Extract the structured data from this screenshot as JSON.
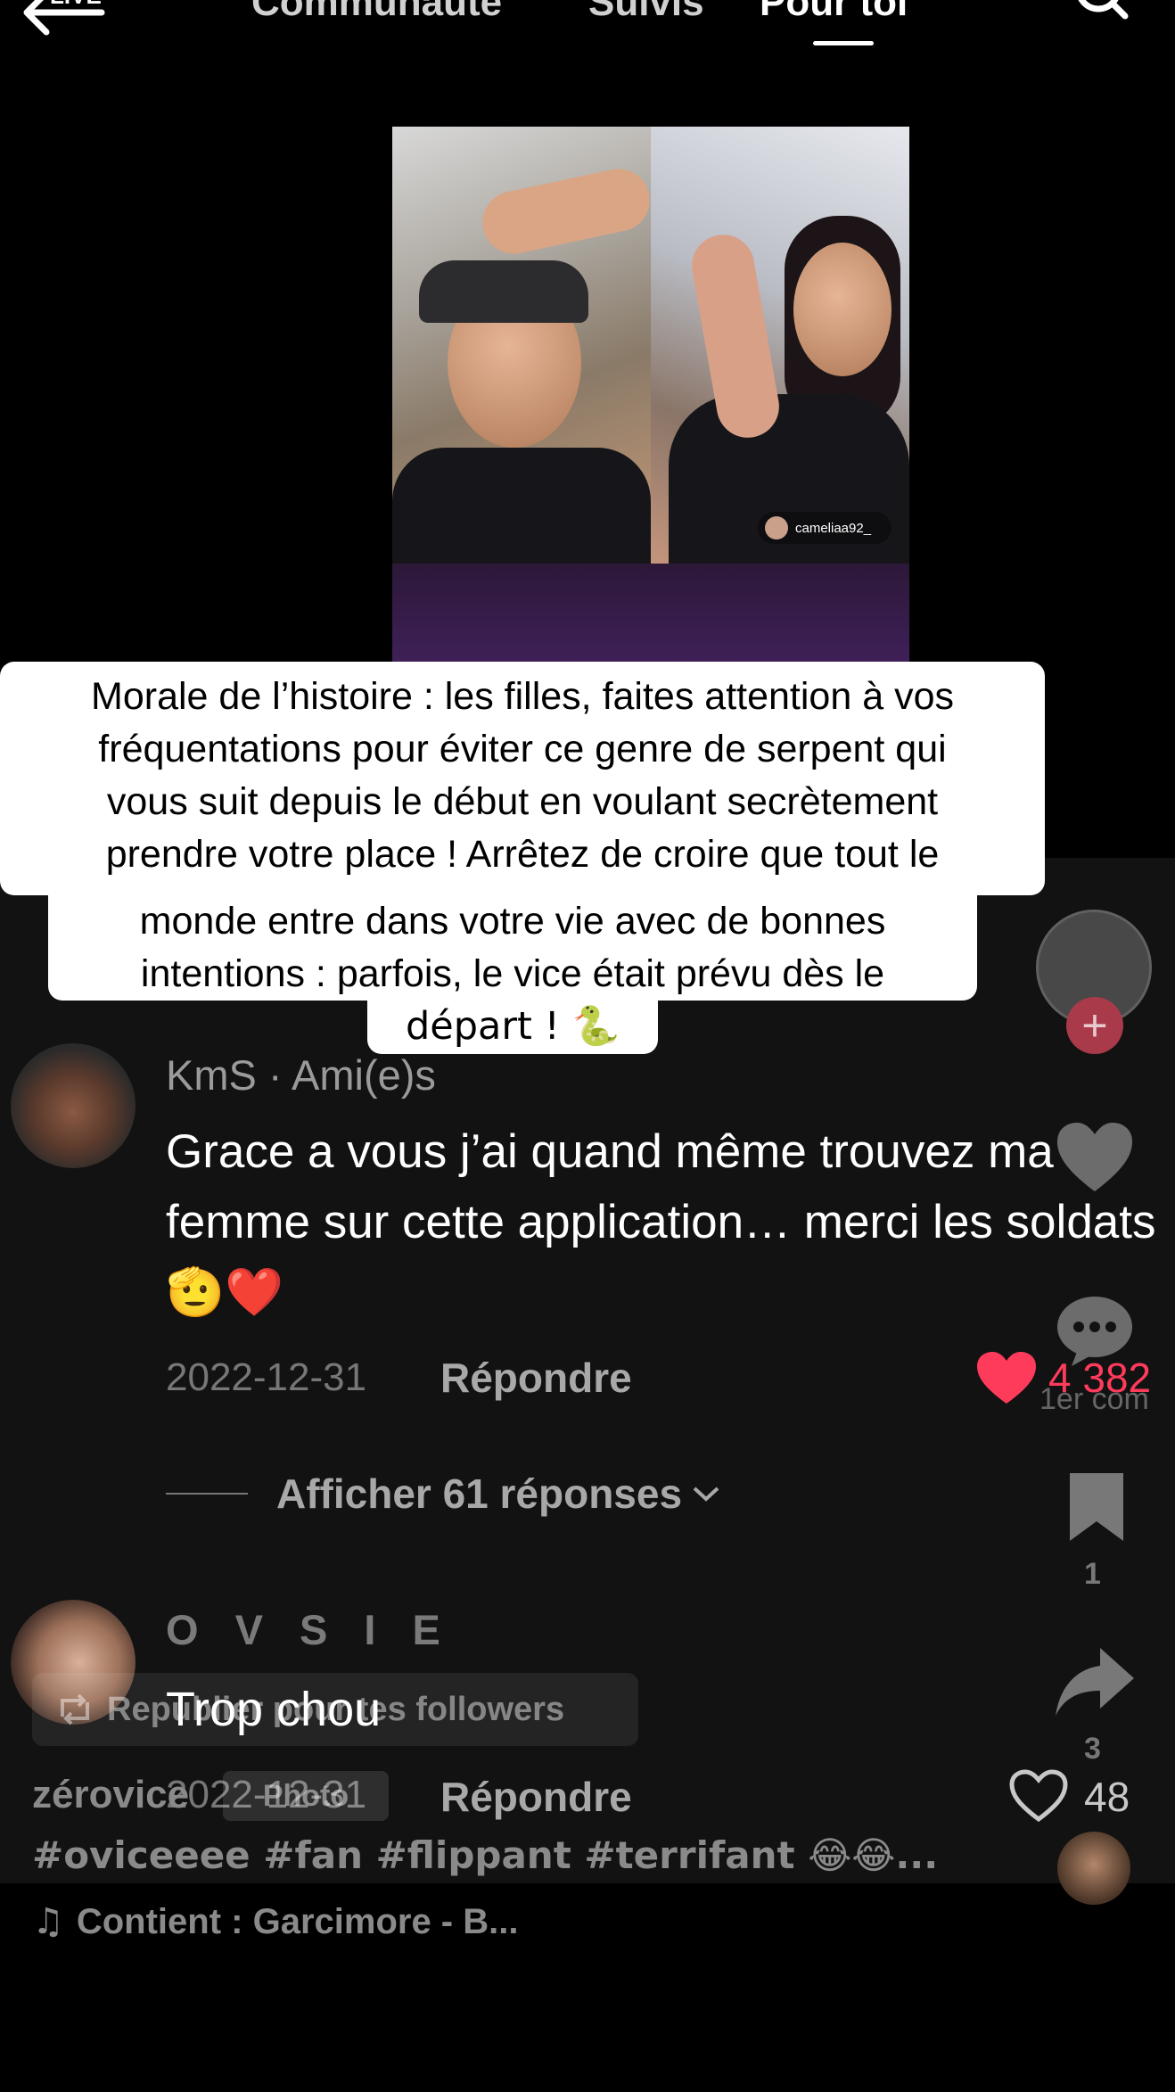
{
  "top_nav": {
    "live_label": "LIVE",
    "tabs": [
      "Communauté",
      "Suivis",
      "Pour toi"
    ],
    "active_tab": "Pour toi"
  },
  "video": {
    "watermark": "cameliaa92_"
  },
  "caption_overlay": {
    "line_group_1": "Morale de l’histoire : les filles, faites attention à vos\nfréquentations pour éviter ce genre de serpent qui\nvous suit depuis le début en voulant secrètement\nprendre votre place ! Arrêtez de croire que tout le",
    "line_group_2": "monde entre dans votre vie avec de bonnes\nintentions : parfois, le vice était prévu dès le",
    "line_group_3": "départ ! 🐍"
  },
  "comments": [
    {
      "username": "KmS · Ami(e)s",
      "text": "Grace a vous j’ai quand même trouvez ma femme sur cette application… merci les soldats",
      "emoji": "🫡❤️",
      "date": "2022-12-31",
      "reply_label": "Répondre",
      "likes": "4 382",
      "liked": true,
      "replies_toggle": "Afficher 61 réponses"
    },
    {
      "username": "O V S I E",
      "text": "Trop chou",
      "date": "2022-12-31",
      "reply_label": "Répondre",
      "likes": "48",
      "liked": false
    }
  ],
  "right_rail": {
    "follow_symbol": "+",
    "like_count": "",
    "comment_label": "1er com",
    "bookmark_count": "1",
    "share_count": "3"
  },
  "video_info": {
    "repost_label": "Republier pour tes followers",
    "author": "zérovice",
    "photo_chip": "Photo",
    "hashtags": "#oviceeee #fan #flippant #terrifant 😂😂...",
    "music": "Contient : Garcimore - B..."
  },
  "colors": {
    "like_active": "#ff3b5c",
    "panel_bg": "#121212",
    "accent_follow": "#a83a4a"
  }
}
